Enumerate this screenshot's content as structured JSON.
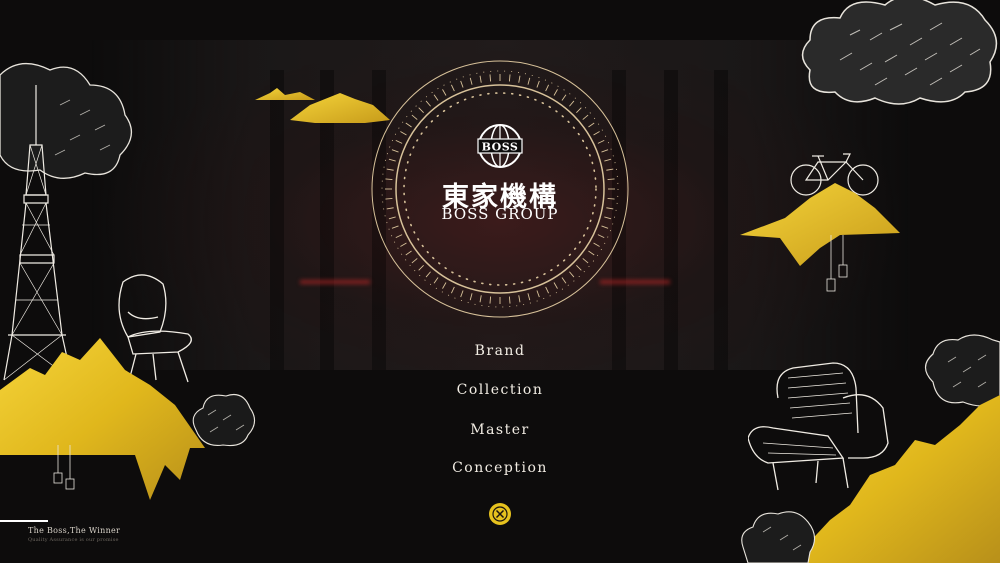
{
  "brand": {
    "name_cn": "東家機構",
    "name_en": "BOSS GROUP",
    "emblem_text": "BOSS"
  },
  "nav": {
    "items": [
      {
        "label": "Brand"
      },
      {
        "label": "Collection"
      },
      {
        "label": "Master"
      },
      {
        "label": "Conception"
      }
    ]
  },
  "footer": {
    "tagline": "The Boss,The Winner",
    "tagline_sub": "Quality Assurance is our promise"
  },
  "colors": {
    "gold": "#e6c21e",
    "background": "#0d0c0c",
    "ring": "#d8c29a",
    "text": "#f2ede4"
  },
  "icons": {
    "close": "close-x-icon",
    "emblem": "globe-emblem-icon"
  }
}
